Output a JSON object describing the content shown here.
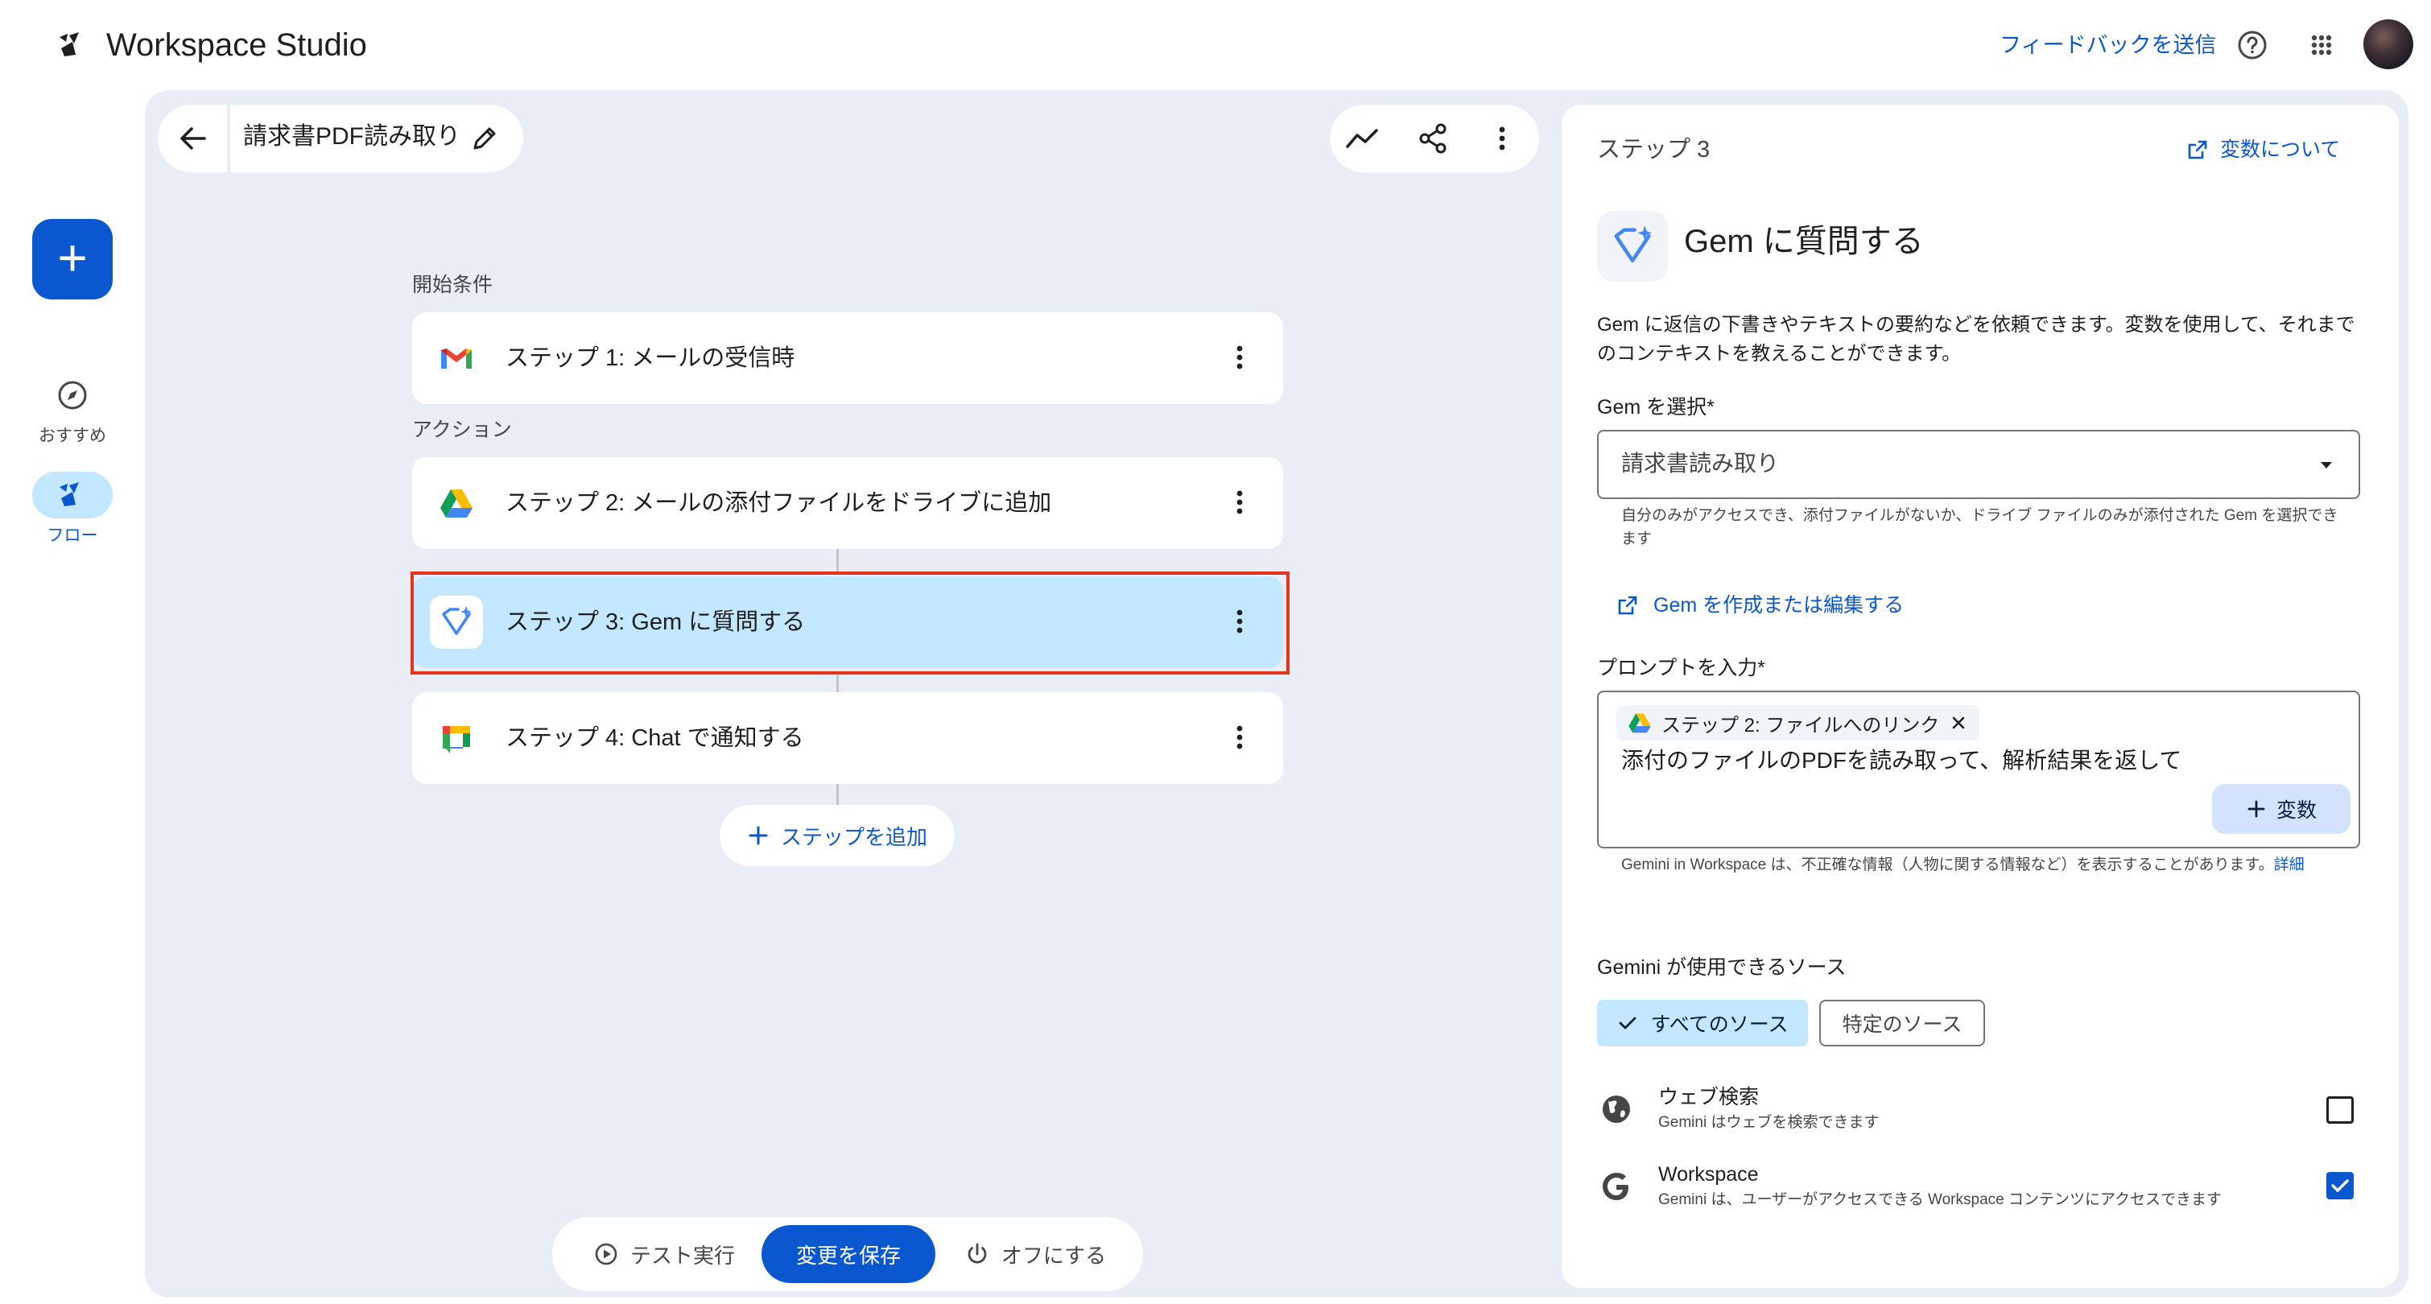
{
  "app": {
    "title": "Workspace Studio"
  },
  "header": {
    "feedback_label": "フィードバックを送信"
  },
  "rail": {
    "create_label": "+",
    "items": [
      {
        "label": "おすすめ"
      },
      {
        "label": "フロー"
      }
    ]
  },
  "flow": {
    "title": "請求書PDF読み取り",
    "trigger_section": "開始条件",
    "action_section": "アクション",
    "steps": [
      {
        "label": "ステップ 1: メールの受信時"
      },
      {
        "label": "ステップ 2: メールの添付ファイルをドライブに追加"
      },
      {
        "label": "ステップ 3: Gem に質問する"
      },
      {
        "label": "ステップ 4: Chat で通知する"
      }
    ],
    "add_step_label": "ステップを追加",
    "test_label": "テスト実行",
    "save_label": "変更を保存",
    "off_label": "オフにする"
  },
  "panel": {
    "step_number": "ステップ 3",
    "variables_link": "変数について",
    "title": "Gem に質問する",
    "description": "Gem に返信の下書きやテキストの要約などを依頼できます。変数を使用して、それまでのコンテキストを教えることができます。",
    "gem_select_label": "Gem を選択*",
    "gem_selected": "請求書読み取り",
    "gem_helper": "自分のみがアクセスでき、添付ファイルがないか、ドライブ ファイルのみが添付された Gem を選択できます",
    "gem_create_link": "Gem を作成または編集する",
    "prompt_label": "プロンプトを入力*",
    "prompt_chip": "ステップ 2: ファイルへのリンク",
    "prompt_text": "添付のファイルのPDFを読み取って、解析結果を返して",
    "variable_button": "変数",
    "disclaimer": "Gemini in Workspace は、不正確な情報（人物に関する情報など）を表示することがあります。",
    "disclaimer_link": "詳細",
    "sources_label": "Gemini が使用できるソース",
    "source_all": "すべてのソース",
    "source_specific": "特定のソース",
    "options": [
      {
        "title": "ウェブ検索",
        "subtitle": "Gemini はウェブを検索できます",
        "checked": false
      },
      {
        "title": "Workspace",
        "subtitle": "Gemini は、ユーザーがアクセスできる Workspace コンテンツにアクセスできます",
        "checked": true
      }
    ]
  },
  "colors": {
    "accent": "#0b57d0",
    "selected_step": "#c2e7ff",
    "highlight": "#e8331c",
    "canvas": "#e9eef6"
  }
}
